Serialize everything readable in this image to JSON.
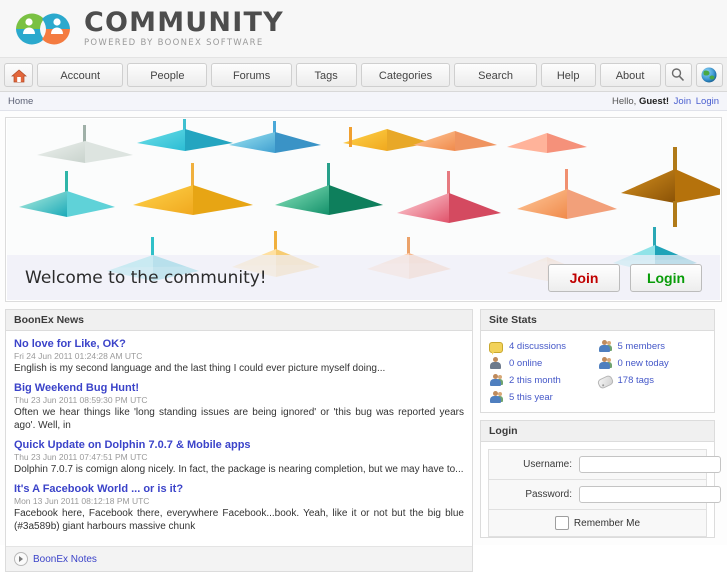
{
  "site": {
    "logo_title": "COMMUNITY",
    "logo_subtitle": "POWERED BY BOONEX SOFTWARE",
    "logo_icon": "two-people-circles-logo"
  },
  "nav": {
    "home_icon": "home-icon",
    "items": [
      {
        "label": "Account"
      },
      {
        "label": "People"
      },
      {
        "label": "Forums"
      },
      {
        "label": "Tags"
      },
      {
        "label": "Categories"
      },
      {
        "label": "Search"
      },
      {
        "label": "Help"
      },
      {
        "label": "About"
      }
    ],
    "search_icon": "magnifier-icon",
    "language_icon": "globe-icon"
  },
  "breadcrumb": {
    "home": "Home",
    "greeting": "Hello, ",
    "guest": "Guest!",
    "join": "Join",
    "login": "Login"
  },
  "banner": {
    "welcome": "Welcome to the community!",
    "join_label": "Join",
    "login_label": "Login",
    "join_color": "#c00000",
    "login_color": "#089c08"
  },
  "news": {
    "title": "BoonEx News",
    "items": [
      {
        "title": "No love for Like, OK?",
        "date": "Fri 24 Jun 2011 01:24:28 AM UTC",
        "desc": "English is my second language and the last thing I could ever picture myself doing..."
      },
      {
        "title": "Big Weekend Bug Hunt!",
        "date": "Thu 23 Jun 2011 08:59:30 PM UTC",
        "desc": "Often we hear things like 'long standing issues are being ignored' or 'this bug was reported years ago'. Well, in"
      },
      {
        "title": "Quick Update on Dolphin 7.0.7 & Mobile apps",
        "date": "Thu 23 Jun 2011 07:47:51 PM UTC",
        "desc": "Dolphin 7.0.7 is comign along nicely.  In fact, the package is nearing completion, but we may have to..."
      },
      {
        "title": "It's A Facebook World ... or is it?",
        "date": "Mon 13 Jun 2011 08:12:18 PM UTC",
        "desc": "Facebook here, Facebook there, everywhere Facebook...book. Yeah, like it or not but the big blue (#3a589b) giant harbours massive chunk"
      }
    ],
    "footer_link": "BoonEx Notes",
    "footer_icon": "play-circle-icon"
  },
  "stats": {
    "title": "Site Stats",
    "left": [
      {
        "icon": "discussions-icon",
        "label": "4 discussions"
      },
      {
        "icon": "member-online-icon",
        "label": "0 online"
      },
      {
        "icon": "members-month-icon",
        "label": "2 this month"
      },
      {
        "icon": "members-year-icon",
        "label": "5 this year"
      }
    ],
    "right": [
      {
        "icon": "members-icon",
        "label": "5 members"
      },
      {
        "icon": "new-today-icon",
        "label": "0 new today"
      },
      {
        "icon": "tag-icon",
        "label": "178 tags"
      }
    ]
  },
  "login": {
    "title": "Login",
    "username_label": "Username:",
    "username_value": "",
    "username_placeholder": "",
    "password_label": "Password:",
    "password_value": "",
    "password_placeholder": "",
    "remember_label": "Remember Me",
    "remember_checked": false
  }
}
